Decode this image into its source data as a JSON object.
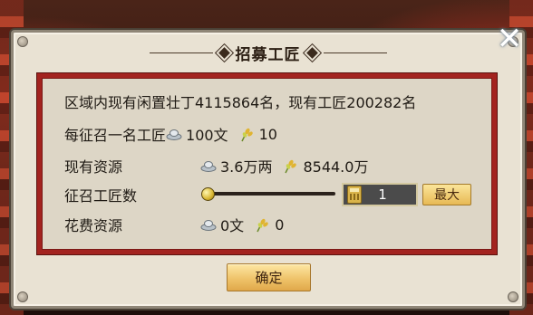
{
  "dialog": {
    "title": "招募工匠",
    "close_icon": "close-icon",
    "summary": "区域内现有闲置壮丁4115864名，现有工匠200282名",
    "cost_per": {
      "label": "每征召一名工匠",
      "silver": "100文",
      "grain": "10"
    },
    "resources": {
      "label": "现有资源",
      "silver": "3.6万两",
      "grain": "8544.0万"
    },
    "recruit": {
      "label": "征召工匠数",
      "slider_fraction": 0,
      "quantity": "1",
      "max_label": "最大"
    },
    "spend": {
      "label": "花费资源",
      "silver": "0文",
      "grain": "0"
    },
    "confirm_label": "确定"
  },
  "icons": {
    "silver": "silver-ingot-icon",
    "grain": "grain-icon",
    "calculator": "calculator-icon"
  },
  "colors": {
    "panel_border": "#a3231f",
    "dialog_bg": "#e9e2d3",
    "button_gold": "#efc36a"
  }
}
